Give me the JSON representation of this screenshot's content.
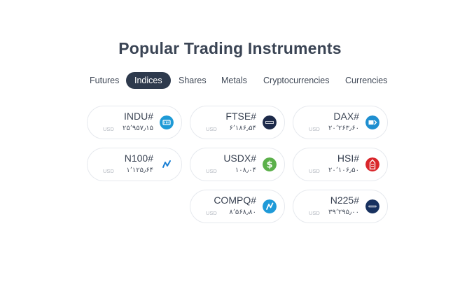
{
  "title": "Popular Trading Instruments",
  "tabs": [
    {
      "label": "Futures",
      "active": false
    },
    {
      "label": "Indices",
      "active": true
    },
    {
      "label": "Shares",
      "active": false
    },
    {
      "label": "Metals",
      "active": false
    },
    {
      "label": "Cryptocurrencies",
      "active": false
    },
    {
      "label": "Currencies",
      "active": false
    }
  ],
  "instruments": [
    {
      "symbol": "INDU#",
      "currency": "USD",
      "price": "۲۵٬۹۵۷٫۱۵",
      "icon": "dji-icon",
      "color": "#1e9ad6"
    },
    {
      "symbol": "FTSE#",
      "currency": "USD",
      "price": "۶٬۱۸۶٫۵۴",
      "icon": "ftse-icon",
      "color": "#1d2a4a"
    },
    {
      "symbol": "DAX#",
      "currency": "USD",
      "price": "۲۰٬۲۶۳٫۶۰",
      "icon": "dax-icon",
      "color": "#1f8fd0"
    },
    {
      "symbol": "N100#",
      "currency": "USD",
      "price": "۱٬۱۲۵٫۶۴",
      "icon": "n100-icon",
      "color": "#1a7fd4"
    },
    {
      "symbol": "USDX#",
      "currency": "USD",
      "price": "۱۰۸٫۰۴",
      "icon": "dollar-icon",
      "color": "#5bb04a"
    },
    {
      "symbol": "HSI#",
      "currency": "USD",
      "price": "۲۰٬۱۰۶٫۵۰",
      "icon": "hsi-icon",
      "color": "#d9262b"
    },
    {
      "symbol": "COMPQ#",
      "currency": "USD",
      "price": "۸٬۵۶۸٫۸۰",
      "icon": "nasdaq-icon",
      "color": "#1f9ad8"
    },
    {
      "symbol": "N225#",
      "currency": "USD",
      "price": "۳۹٬۲۹۵٫۰۰",
      "icon": "nikkei-icon",
      "color": "#17315f"
    }
  ]
}
